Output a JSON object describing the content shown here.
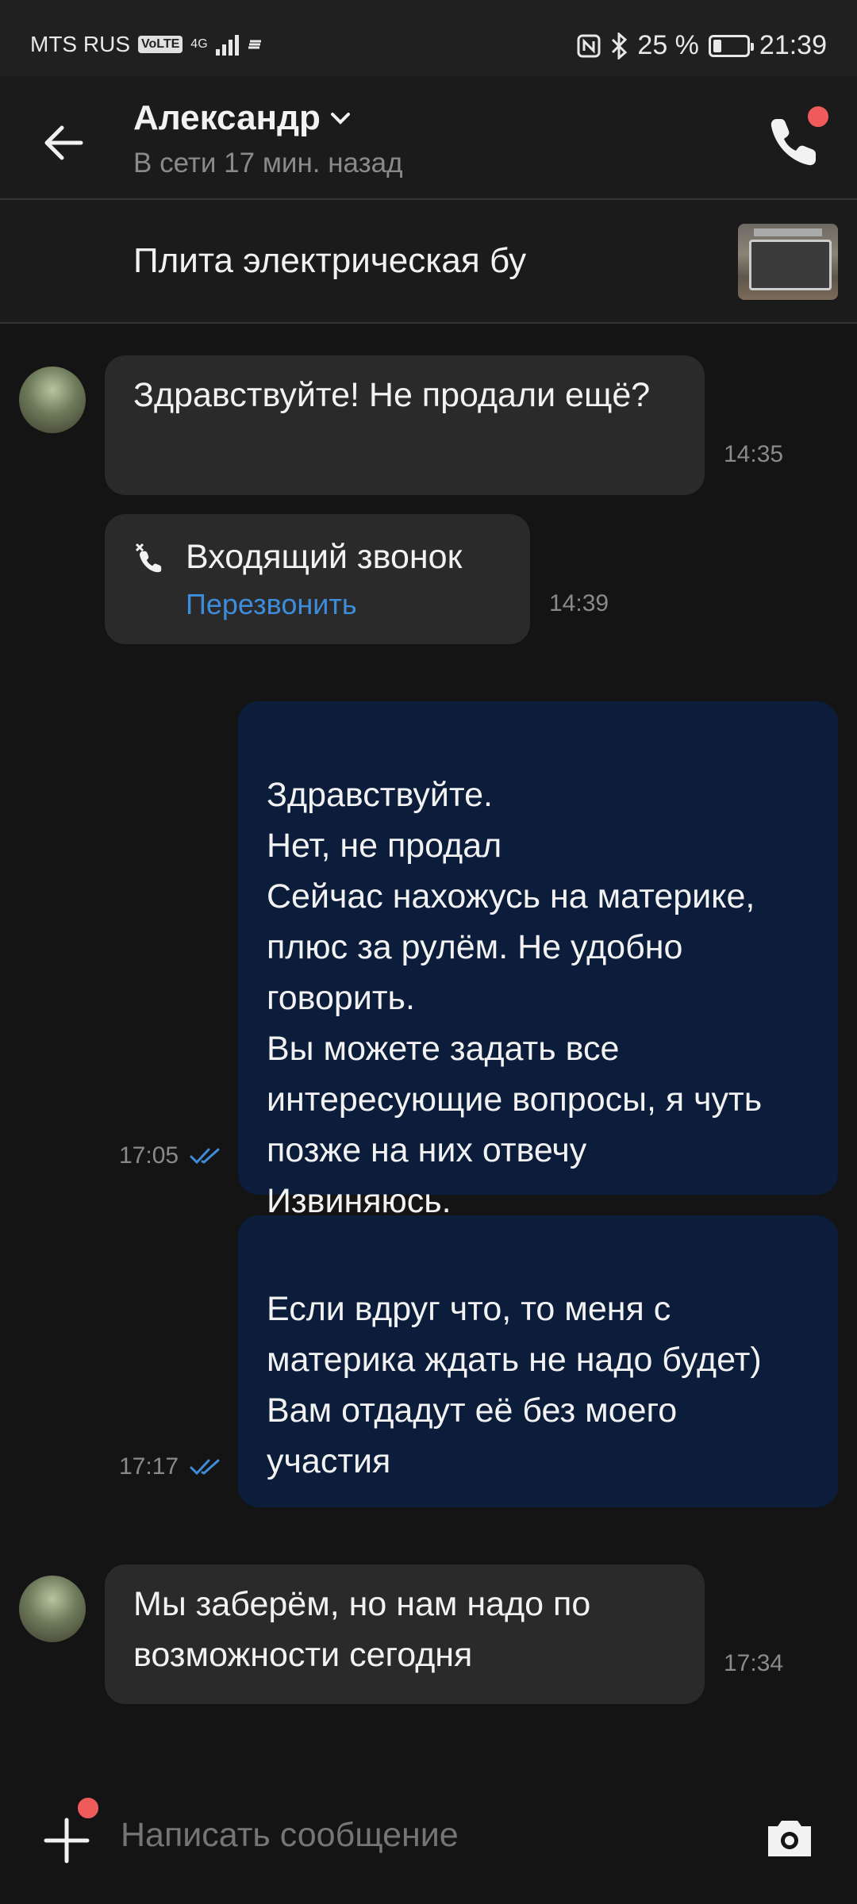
{
  "status_bar": {
    "carrier": "MTS RUS",
    "volte": "VoLTE",
    "network": "4G",
    "battery_percent": "25 %",
    "battery_level": 0.25,
    "time": "21:39"
  },
  "header": {
    "contact_name": "Александр",
    "online_status": "В сети 17 мин. назад"
  },
  "listing": {
    "title": "Плита электрическая бу"
  },
  "messages": [
    {
      "direction": "incoming",
      "text": "Здравствуйте! Не продали ещё?",
      "time": "14:35"
    },
    {
      "direction": "incoming",
      "type": "call",
      "title": "Входящий звонок",
      "action": "Перезвонить",
      "time": "14:39"
    },
    {
      "direction": "outgoing",
      "text": "Здравствуйте.\nНет, не продал\nСейчас нахожусь на материке, плюс за рулём. Не удобно говорить.\nВы можете задать все интересующие вопросы, я чуть позже на них отвечу\nИзвиняюсь.",
      "time": "17:05"
    },
    {
      "direction": "outgoing",
      "text": "Если вдруг что, то меня с материка ждать не надо будет)\nВам отдадут её без моего участия",
      "time": "17:17"
    },
    {
      "direction": "incoming",
      "text": "Мы заберём, но нам надо по возможности сегодня",
      "time": "17:34"
    }
  ],
  "composer": {
    "placeholder": "Написать сообщение"
  },
  "colors": {
    "background": "#141414",
    "incoming_bubble": "#2a2a2a",
    "outgoing_bubble": "#0b1d3a",
    "link": "#3e8ddc",
    "notification_dot": "#ef5b5b"
  }
}
